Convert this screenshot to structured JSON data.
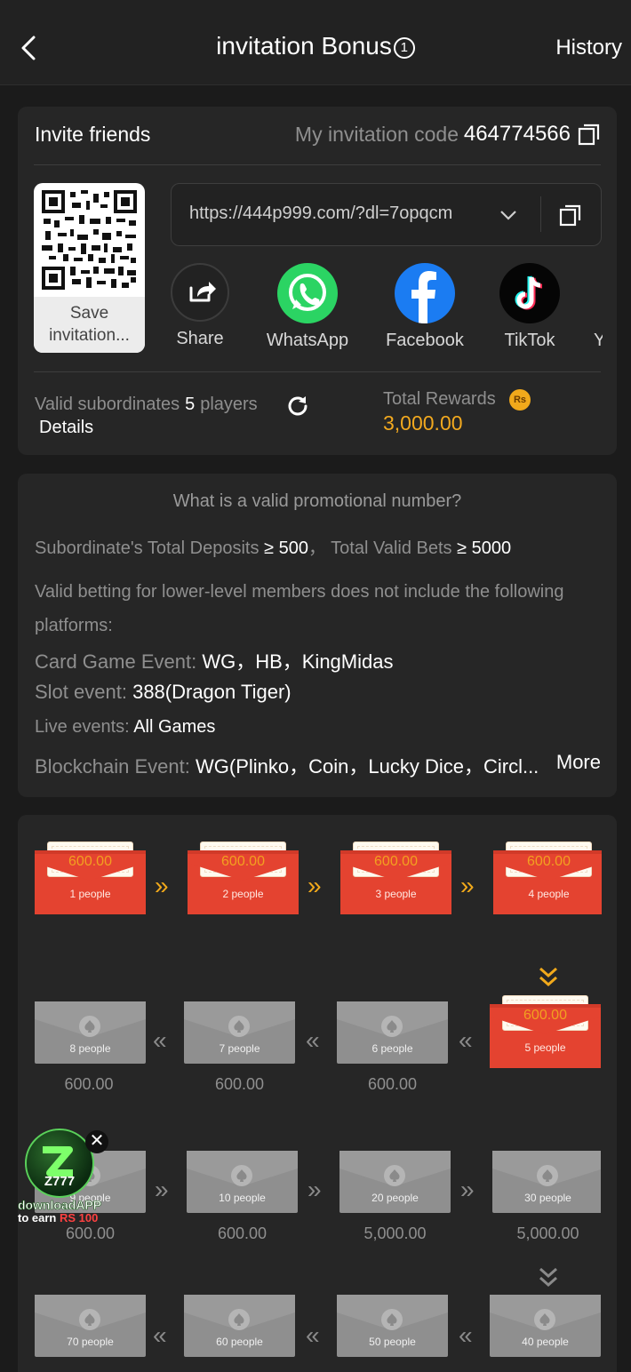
{
  "header": {
    "title": "invitation Bonus",
    "info_glyph": "1",
    "history_label": "History"
  },
  "invite": {
    "title": "Invite friends",
    "code_label": "My invitation code",
    "code_value": "464774566",
    "qr_save_label": "Save invitation...",
    "url": "https://444p999.com/?dl=7opqcm",
    "share": [
      {
        "label": "Share",
        "icon": "share-icon"
      },
      {
        "label": "WhatsApp",
        "icon": "whatsapp-icon"
      },
      {
        "label": "Facebook",
        "icon": "facebook-icon"
      },
      {
        "label": "TikTok",
        "icon": "tiktok-icon"
      },
      {
        "label": "Y",
        "icon": "youtube-icon"
      }
    ],
    "subordinates_label": "Valid subordinates",
    "subordinates_count": "5",
    "subordinates_unit": "players",
    "details_label": "Details",
    "rewards_label": "Total Rewards",
    "rewards_currency": "Rs",
    "rewards_value": "3,000.00"
  },
  "rules": {
    "heading": "What is a valid promotional number?",
    "deposit_line_label": "Subordinate's Total Deposits",
    "deposit_value": "≥ 500",
    "bets_line_label": "Total Valid Bets",
    "bets_value": "≥ 5000",
    "exclusion_text": "Valid betting for lower-level members does not include the following platforms:",
    "card_label": "Card Game Event:",
    "card_value": "WG，HB，KingMidas",
    "slot_label": "Slot event:",
    "slot_value": "388(Dragon Tiger)",
    "live_label": "Live events:",
    "live_value": "All Games",
    "blockchain_label": "Blockchain Event:",
    "blockchain_value": "WG(Plinko，Coin，Lucky Dice，Circl...",
    "more_label": "More"
  },
  "tiers": [
    {
      "people": "1 people",
      "amount": "600.00",
      "status": "claimed"
    },
    {
      "people": "2 people",
      "amount": "600.00",
      "status": "claimed"
    },
    {
      "people": "3 people",
      "amount": "600.00",
      "status": "claimed"
    },
    {
      "people": "4 people",
      "amount": "600.00",
      "status": "claimed"
    },
    {
      "people": "5 people",
      "amount": "600.00",
      "status": "claimed"
    },
    {
      "people": "6 people",
      "amount": "600.00",
      "status": "locked"
    },
    {
      "people": "7 people",
      "amount": "600.00",
      "status": "locked"
    },
    {
      "people": "8 people",
      "amount": "600.00",
      "status": "locked"
    },
    {
      "people": "9 people",
      "amount": "600.00",
      "status": "locked"
    },
    {
      "people": "10 people",
      "amount": "600.00",
      "status": "locked"
    },
    {
      "people": "20 people",
      "amount": "5,000.00",
      "status": "locked"
    },
    {
      "people": "30 people",
      "amount": "5,000.00",
      "status": "locked"
    },
    {
      "people": "40 people",
      "amount": "",
      "status": "locked"
    },
    {
      "people": "50 people",
      "amount": "",
      "status": "locked"
    },
    {
      "people": "60 people",
      "amount": "",
      "status": "locked"
    },
    {
      "people": "70 people",
      "amount": "",
      "status": "locked"
    }
  ],
  "float_widget": {
    "logo_text": "Z777",
    "line1": "downloadAPP",
    "line2_prefix": "to earn",
    "line2_amount": "RS 100",
    "close_glyph": "✕"
  },
  "colors": {
    "accent_orange": "#f1a91b",
    "envelope_red": "#e44330",
    "envelope_grey": "#8f8f8f",
    "background": "#1b1b1b",
    "card": "#262626"
  }
}
